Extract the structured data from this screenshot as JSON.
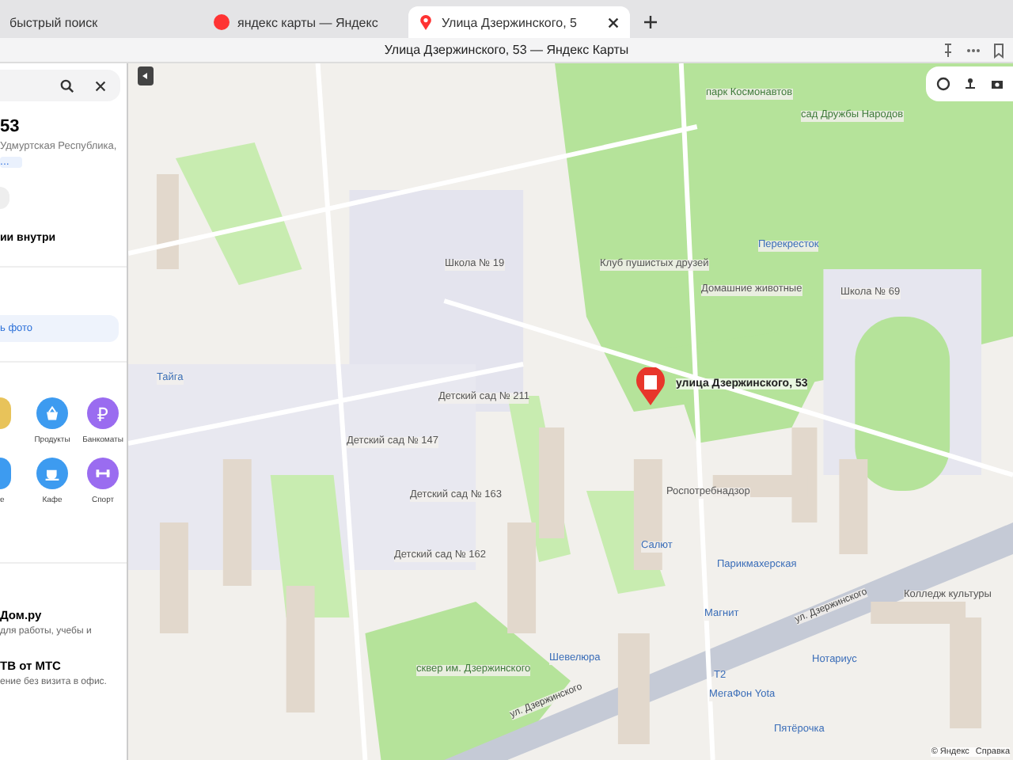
{
  "browser": {
    "tabs": [
      {
        "label": "быстрый поиск",
        "selected": false,
        "kind": "plain"
      },
      {
        "label": "яндекс карты — Яндекс",
        "selected": false,
        "kind": "search"
      },
      {
        "label": "Улица Дзержинского, 5",
        "selected": true,
        "kind": "maps"
      }
    ],
    "title": "Улица Дзержинского, 53 — Яндекс Карты"
  },
  "sidebar": {
    "heading": "53",
    "address": "Удмуртская Республика,",
    "more": "...",
    "section": "ии внутри",
    "photo_button": "ь фото",
    "categories": [
      {
        "kind": "cut",
        "color": "#e8c35a"
      },
      {
        "kind": "basket",
        "color": "#3d9bf0",
        "label": "Продукты"
      },
      {
        "kind": "ruble",
        "color": "#9a6cf0",
        "label": "Банкоматы",
        "glyph": "₽"
      },
      {
        "kind": "cut",
        "color": "#3d9bf0",
        "label": "е"
      },
      {
        "kind": "cup",
        "color": "#3d9bf0",
        "label": "Кафе"
      },
      {
        "kind": "dumbbell",
        "color": "#9a6cf0",
        "label": "Спорт"
      }
    ],
    "ads": [
      {
        "title": "Дом.ру",
        "text": "для работы, учебы и"
      },
      {
        "title": "ТВ от МТС",
        "text": "ение без визита в офис."
      }
    ]
  },
  "map": {
    "marker_label": "улица Дзержинского, 53",
    "labels": [
      {
        "text": "парк Космонавтов",
        "kind": "park"
      },
      {
        "text": "сад Дружбы Народов",
        "kind": "park"
      },
      {
        "text": "Школа № 19",
        "kind": "poi"
      },
      {
        "text": "Перекресток",
        "kind": "shop"
      },
      {
        "text": "Клуб пушистых друзей",
        "kind": "poi"
      },
      {
        "text": "Домашние животные",
        "kind": "poi"
      },
      {
        "text": "Школа № 69",
        "kind": "poi"
      },
      {
        "text": "Тайга",
        "kind": "shop"
      },
      {
        "text": "Детский сад № 211",
        "kind": "poi"
      },
      {
        "text": "Детский сад № 147",
        "kind": "poi"
      },
      {
        "text": "Детский сад № 163",
        "kind": "poi"
      },
      {
        "text": "Детский сад № 162",
        "kind": "poi"
      },
      {
        "text": "Роспотребнадзор",
        "kind": "poi"
      },
      {
        "text": "Салют",
        "kind": "shop"
      },
      {
        "text": "Парикмахерская",
        "kind": "shop"
      },
      {
        "text": "Магнит",
        "kind": "shop"
      },
      {
        "text": "ул. Дзержинского",
        "kind": "street"
      },
      {
        "text": "ул. Дзержинского",
        "kind": "street"
      },
      {
        "text": "Шевелюра",
        "kind": "shop"
      },
      {
        "text": "Колледж культуры",
        "kind": "poi"
      },
      {
        "text": "Нотариус",
        "kind": "shop"
      },
      {
        "text": "Т2",
        "kind": "shop"
      },
      {
        "text": "МегаФон Yota",
        "kind": "shop"
      },
      {
        "text": "Пятёрочка",
        "kind": "shop"
      },
      {
        "text": "сквер им. Дзержинского",
        "kind": "park"
      }
    ],
    "footer": [
      "© Яндекс",
      "Справка"
    ]
  }
}
